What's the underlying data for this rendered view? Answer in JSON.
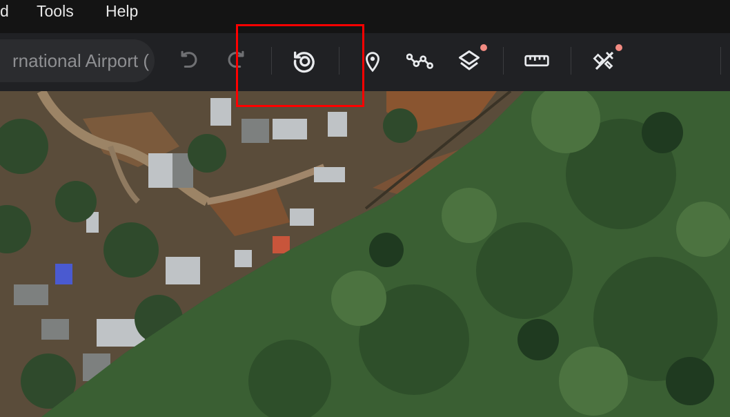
{
  "menu": {
    "items": [
      "d",
      "Tools",
      "Help"
    ]
  },
  "search": {
    "value": "rnational Airport ("
  },
  "toolbar": {
    "buttons": [
      "undo-icon",
      "redo-icon",
      "history-icon",
      "placemark-icon",
      "path-icon",
      "layers-icon",
      "ruler-icon",
      "tools-icon"
    ],
    "accent": "#f28b82"
  },
  "highlight_color": "#ff0000"
}
